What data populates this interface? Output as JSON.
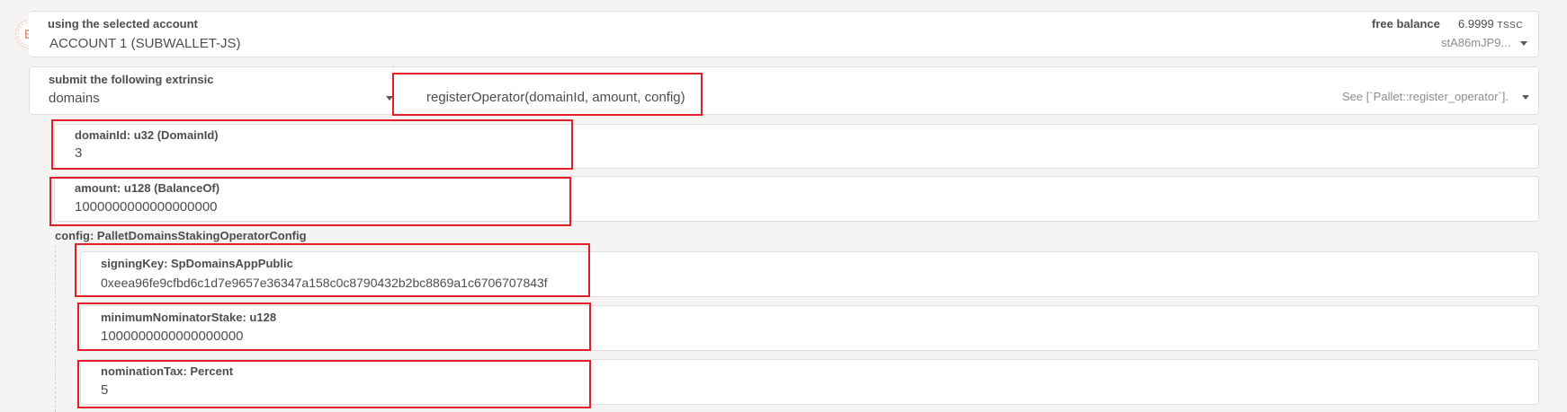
{
  "account": {
    "label": "using the selected account",
    "name": "ACCOUNT 1 (SUBWALLET-JS)",
    "balance_label": "free balance",
    "balance_value": "6.9999",
    "balance_unit": "TSSC",
    "address": "stA86mJP9..."
  },
  "extrinsic": {
    "label": "submit the following extrinsic",
    "section": "domains",
    "method": "registerOperator(domainId, amount, config)",
    "doc": "See [`Pallet::register_operator`]."
  },
  "params": {
    "domain_id": {
      "label": "domainId: u32 (DomainId)",
      "value": "3"
    },
    "amount": {
      "label": "amount: u128 (BalanceOf)",
      "value": "1000000000000000000"
    },
    "config_label": "config: PalletDomainsStakingOperatorConfig",
    "signing_key": {
      "label": "signingKey: SpDomainsAppPublic",
      "value": "0xeea96fe9cfbd6c1d7e9657e36347a158c0c8790432b2bc8869a1c6706707843f"
    },
    "min_nominator_stake": {
      "label": "minimumNominatorStake: u128",
      "value": "1000000000000000000"
    },
    "nomination_tax": {
      "label": "nominationTax: Percent",
      "value": "5"
    }
  },
  "colors": {
    "highlight": "#e21f26",
    "background": "#f5f4f3",
    "field": "#ffffff"
  },
  "icons": [
    "identicon-icon",
    "chevron-down-icon"
  ]
}
